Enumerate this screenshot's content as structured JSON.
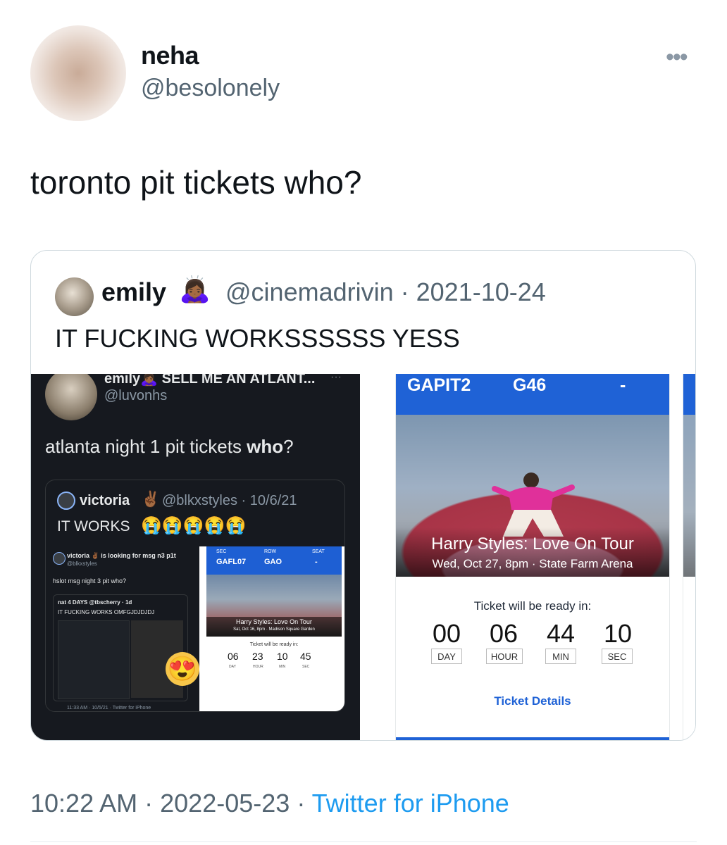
{
  "tweet": {
    "author_name": "neha",
    "author_handle": "@besolonely",
    "more_icon": "ellipsis-icon",
    "text": "toronto pit tickets who?",
    "time": "10:22 AM",
    "date": "2022-05-23",
    "separator": "·",
    "source": "Twitter for iPhone"
  },
  "quote": {
    "author_name": "emily",
    "author_emoji": "🙇🏾‍♀️",
    "author_handle": "@cinemadrivin",
    "date": "· 2021-10-24",
    "text": "IT FUCKING WORKSSSSSS YESS",
    "screenshot_left": {
      "name_line": "emily🙇🏾‍♀️ SELL ME AN ATLANT...",
      "dots": "···",
      "handle": "@luvonhs",
      "text_plain": "atlanta night 1 pit tickets ",
      "text_bold": "who",
      "text_end": "?",
      "nested": {
        "name": "victoria",
        "emoji": "✌🏾",
        "handle": "@blkxstyles · 10/6/21",
        "text": "IT WORKS",
        "text_emoji": "😭😭😭😭😭",
        "mini_name": "victoria ✌🏾 is looking for msg n3 p1t",
        "mini_handle": "@blkxstyles",
        "mini_text": "hslot msg night 3 pit who?",
        "mini_nested_name": "nat 4 DAYS @tbscherry · 1d",
        "mini_nested_text": "IT FUCKING WORKS OMFGJDJDJDJ",
        "mini_footer": "11:33 AM · 10/5/21 · Twitter for iPhone",
        "mini_ticket_sec_label": "SEC",
        "mini_ticket_row_label": "ROW",
        "mini_ticket_seat_label": "SEAT",
        "mini_ticket_sec": "GAFL07",
        "mini_ticket_row": "GAO",
        "mini_ticket_seat": "-",
        "mini_ticket_title": "Harry Styles: Love On Tour",
        "mini_ticket_sub": "Sat, Oct 16, 8pm · Madison Square Garden",
        "mini_ticket_ready": "Ticket will be ready in:",
        "mini_cd": [
          "06",
          "23",
          "10",
          "45"
        ],
        "mini_cd_labels": [
          "DAY",
          "HOUR",
          "MIN",
          "SEC"
        ],
        "face_emoji": "😍"
      }
    },
    "screenshot_right": {
      "sec": "GAPIT2",
      "row": "G46",
      "seat": "-",
      "title": "Harry Styles: Love On Tour",
      "subtitle": "Wed, Oct 27, 8pm · State Farm Arena",
      "ready_text": "Ticket will be ready in:",
      "countdown": [
        {
          "value": "00",
          "label": "DAY"
        },
        {
          "value": "06",
          "label": "HOUR"
        },
        {
          "value": "44",
          "label": "MIN"
        },
        {
          "value": "10",
          "label": "SEC"
        }
      ],
      "details_link": "Ticket Details"
    }
  },
  "colors": {
    "link_blue": "#1d9bf0",
    "ticket_blue": "#1f62d6",
    "secondary_text": "#536471",
    "dark_bg": "#16191f"
  }
}
